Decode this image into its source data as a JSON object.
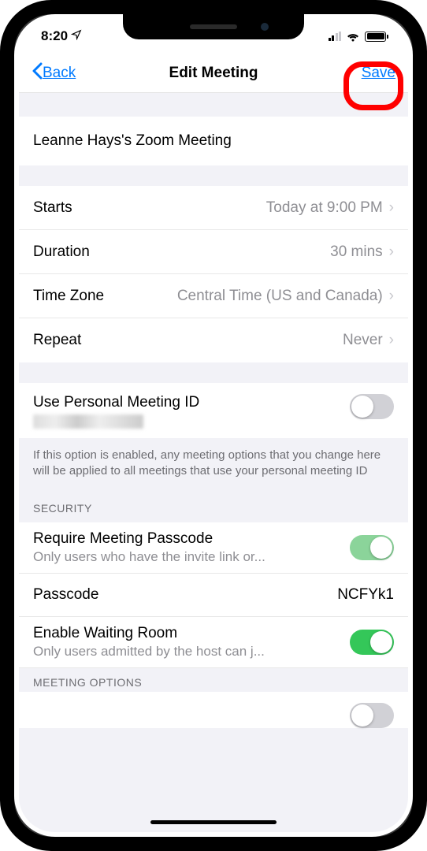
{
  "status": {
    "time": "8:20"
  },
  "nav": {
    "back_label": "Back",
    "title": "Edit Meeting",
    "save_label": "Save"
  },
  "meeting": {
    "title": "Leanne Hays's Zoom Meeting"
  },
  "schedule": {
    "starts": {
      "label": "Starts",
      "value": "Today at 9:00 PM"
    },
    "duration": {
      "label": "Duration",
      "value": "30 mins"
    },
    "timezone": {
      "label": "Time Zone",
      "value": "Central Time (US and Canada)"
    },
    "repeat": {
      "label": "Repeat",
      "value": "Never"
    }
  },
  "pmi": {
    "label": "Use Personal Meeting ID",
    "footer": "If this option is enabled, any meeting options that you change here will be applied to all meetings that use your personal meeting ID"
  },
  "security": {
    "header": "SECURITY",
    "passcode_toggle": {
      "label": "Require Meeting Passcode",
      "sub": "Only users who have the invite link or..."
    },
    "passcode": {
      "label": "Passcode",
      "value": "NCFYk1"
    },
    "waiting_room": {
      "label": "Enable Waiting Room",
      "sub": "Only users admitted by the host can j..."
    }
  },
  "meeting_options": {
    "header": "MEETING OPTIONS"
  }
}
